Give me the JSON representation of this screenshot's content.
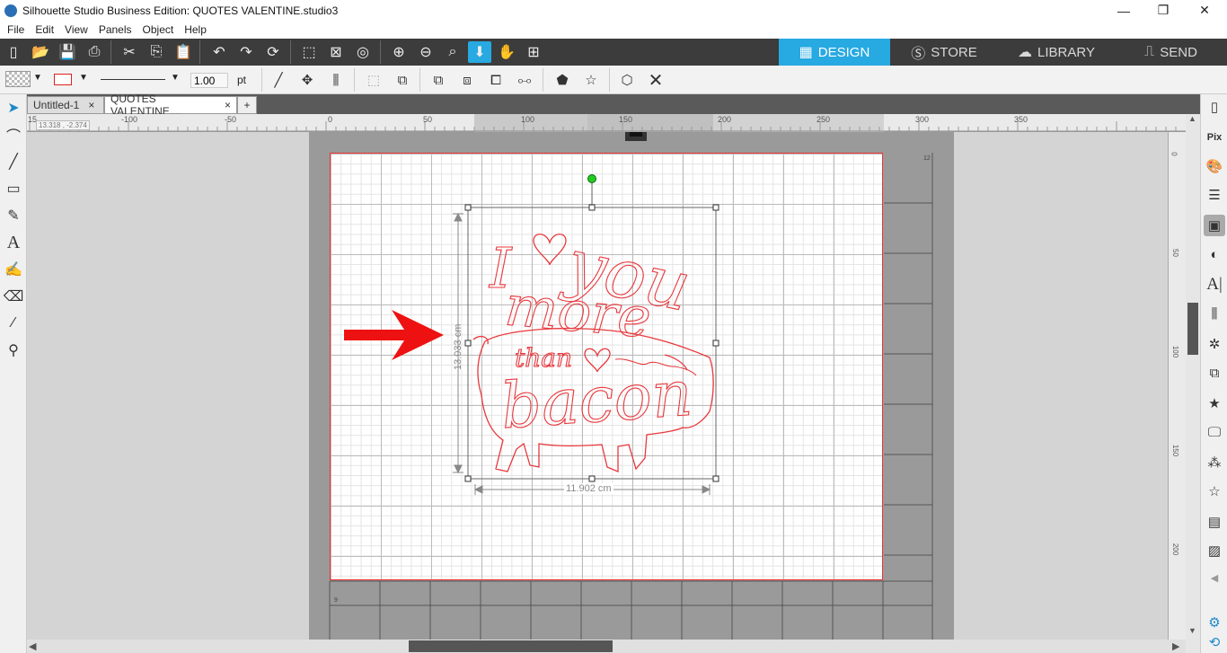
{
  "window": {
    "title": "Silhouette Studio Business Edition: QUOTES VALENTINE.studio3",
    "minimize": "—",
    "restore": "❐",
    "close": "✕"
  },
  "menu": [
    "File",
    "Edit",
    "View",
    "Panels",
    "Object",
    "Help"
  ],
  "nav_tabs": [
    {
      "label": "DESIGN",
      "icon": "grid-icon",
      "active": true
    },
    {
      "label": "STORE",
      "icon": "silhouette-s-icon",
      "active": false
    },
    {
      "label": "LIBRARY",
      "icon": "cloud-icon",
      "active": false
    },
    {
      "label": "SEND",
      "icon": "cutter-icon",
      "active": false
    }
  ],
  "line_style": {
    "width_value": "1.00",
    "unit": "pt"
  },
  "doc_tabs": [
    {
      "label": "Untitled-1",
      "close": "×",
      "active": false
    },
    {
      "label": "QUOTES VALENTINE....",
      "close": "×",
      "active": true
    }
  ],
  "add_tab": "+",
  "ruler": {
    "coord_readout": "13.318 , -2.374",
    "corner_label": "15",
    "h_labels": [
      "-100",
      "-50",
      "0",
      "50",
      "100",
      "150",
      "200",
      "250",
      "300",
      "350"
    ],
    "v_labels": [
      "0",
      "50",
      "100",
      "150",
      "200"
    ]
  },
  "design": {
    "line1": "I you",
    "line2": "more",
    "line3": "than",
    "line4": "bacon",
    "height_dim": "13.033 cm",
    "width_dim": "11.902 cm",
    "accent_color": "#e8383d"
  },
  "mat_labels": {
    "top_right": "12",
    "bottom_left": "9"
  },
  "colors": {
    "design_tab": "#27a9e1",
    "toolbar_bg": "#3c3c3c",
    "cut_line": "#e33333",
    "arrow": "#ee1111"
  }
}
